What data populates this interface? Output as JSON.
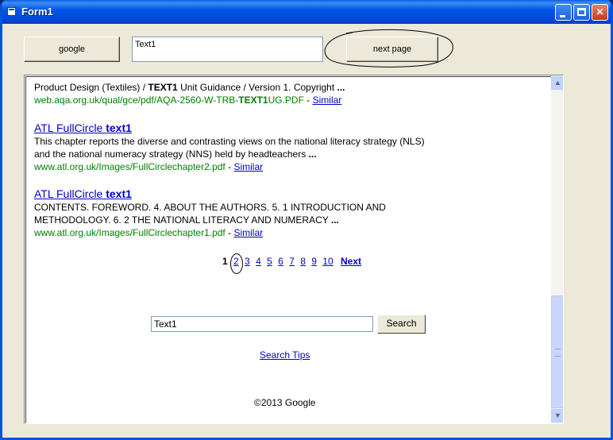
{
  "window": {
    "title": "Form1"
  },
  "form": {
    "google_button": "google",
    "text_box_value": "Text1",
    "next_page_button": "next page"
  },
  "results": [
    {
      "snippet_pre": "Product Design (Textiles) / ",
      "snippet_bold": "TEXT1",
      "snippet_post": " Unit Guidance / Version 1. Copyright ",
      "snippet_ellipsis": "...",
      "url_pre": "web.aqa.org.uk/qual/gce/pdf/AQA-2560-W-TRB-",
      "url_bold": "TEXT1",
      "url_post": "UG.PDF",
      "url_sep": " - ",
      "similar": "Similar"
    },
    {
      "title_pre": "ATL FullCircle ",
      "title_bold": "text1",
      "snippet_line1": "This chapter reports the diverse and contrasting views on the national literacy strategy (NLS)",
      "snippet_line2": "and the national numeracy strategy (NNS) held by headteachers ",
      "snippet_ellipsis": "...",
      "url": "www.atl.org.uk/Images/FullCirclechapter2.pdf",
      "url_sep": " - ",
      "similar": "Similar"
    },
    {
      "title_pre": "ATL FullCircle ",
      "title_bold": "text1",
      "snippet_line1": "CONTENTS. FOREWORD. 4. ABOUT THE AUTHORS. 5. 1 INTRODUCTION AND",
      "snippet_line2": "METHODOLOGY. 6. 2 THE NATIONAL LITERACY AND NUMERACY ",
      "snippet_ellipsis": "...",
      "url": "www.atl.org.uk/Images/FullCirclechapter1.pdf",
      "url_sep": " - ",
      "similar": "Similar"
    }
  ],
  "pagination": {
    "current": "1",
    "pages": [
      "2",
      "3",
      "4",
      "5",
      "6",
      "7",
      "8",
      "9",
      "10"
    ],
    "next": "Next"
  },
  "bottom_search": {
    "value": "Text1",
    "button": "Search",
    "tips": "Search Tips"
  },
  "footer": "©2013 Google",
  "icons": [
    "form-icon",
    "minimize-icon",
    "maximize-icon",
    "close-icon",
    "scroll-up-icon",
    "scroll-down-icon"
  ]
}
